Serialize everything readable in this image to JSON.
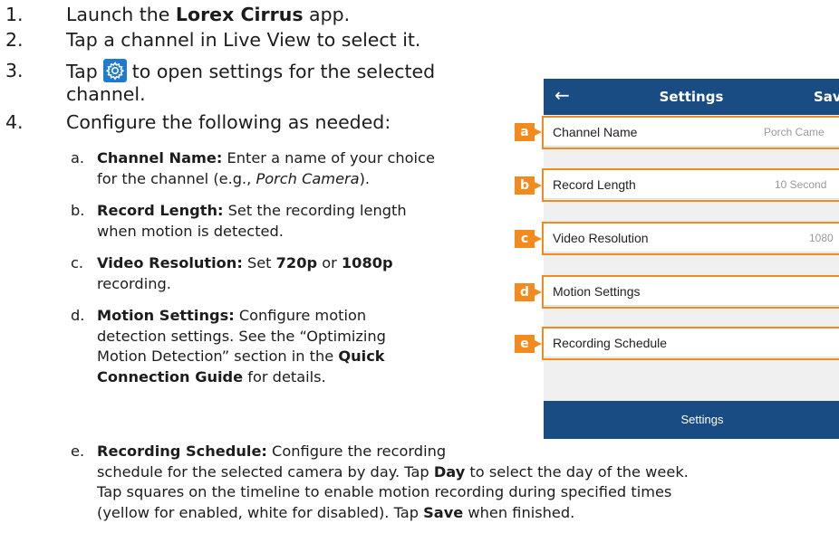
{
  "steps": [
    {
      "number": "1.",
      "pre": "Launch the ",
      "bold": "Lorex Cirrus",
      "post": " app."
    },
    {
      "number": "2.",
      "text": "Tap a channel in Live View to select it."
    },
    {
      "number": "3.",
      "pre": "Tap",
      "post": "to open settings for the selected",
      "cont": "channel.",
      "icon": "gear-icon"
    },
    {
      "number": "4.",
      "text": "Configure the following as needed:"
    }
  ],
  "substeps": {
    "a": {
      "letter": "a.",
      "bold": "Channel Name:",
      "line1": " Enter a name of your choice",
      "line2_pre": "for the channel (e.g., ",
      "line2_italic": "Porch Camera",
      "line2_post": ")."
    },
    "b": {
      "letter": "b.",
      "bold": "Record Length:",
      "line1": " Set the recording length",
      "line2": "when motion is detected."
    },
    "c": {
      "letter": "c.",
      "bold": "Video Resolution:",
      "line1_pre": " Set ",
      "bold_720": "720p",
      "line1_mid": " or ",
      "bold_1080": "1080p",
      "line2": "recording."
    },
    "d": {
      "letter": "d.",
      "bold": "Motion Settings:",
      "line1": " Configure motion",
      "line2": "detection settings. See the “Optimizing",
      "line3_pre": "Motion Detection” section in the ",
      "line3_bold": "Quick",
      "line4_bold": "Connection Guide",
      "line4_post": " for details."
    },
    "e": {
      "letter": "e.",
      "bold": "Recording Schedule:",
      "line1": " Configure the recording",
      "line2_pre": "schedule for the selected camera by day. Tap ",
      "line2_bold": "Day",
      "line2_post": " to select the day of the week.",
      "line3": "Tap squares on the timeline to enable motion recording during specified times",
      "line4_pre": "(yellow for enabled, white for disabled). Tap ",
      "line4_bold": "Save",
      "line4_post": " when finished."
    }
  },
  "phone": {
    "header": {
      "back_icon": "arrow-left-icon",
      "back_glyph": "←",
      "title": "Settings",
      "save": "Sav"
    },
    "rows": [
      {
        "label": "Channel Name",
        "value": "Porch Came",
        "callout": "a"
      },
      {
        "label": "Record Length",
        "value": "10 Second",
        "callout": "b"
      },
      {
        "label": "Video Resolution",
        "value": "1080",
        "callout": "c"
      },
      {
        "label": "Motion Settings",
        "value": "",
        "callout": "d"
      },
      {
        "label": "Recording Schedule",
        "value": "",
        "callout": "e"
      }
    ],
    "footer": "Settings"
  },
  "colors": {
    "accent": "#f28a1d",
    "header": "#1a4c84",
    "gear_bg": "#1f7ad1"
  }
}
